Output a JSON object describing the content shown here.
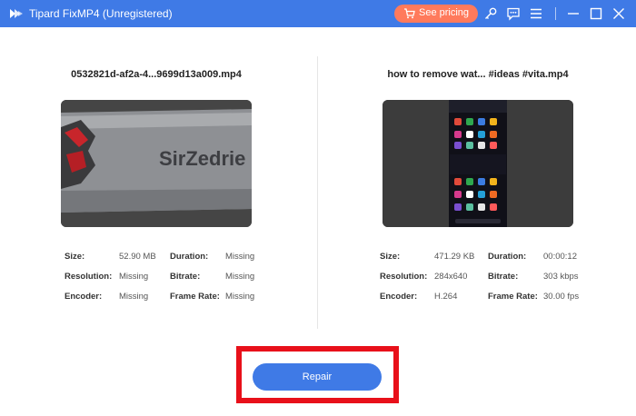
{
  "app": {
    "title": "Tipard FixMP4 (Unregistered)",
    "pricing_label": "See pricing",
    "icons": [
      "logo-icon",
      "cart-icon",
      "key-icon",
      "feedback-icon",
      "menu-icon",
      "minimize-icon",
      "maximize-icon",
      "close-icon"
    ]
  },
  "left": {
    "filename": "0532821d-af2a-4...9699d13a009.mp4",
    "thumb_text": "SirZedrie",
    "props": {
      "size_label": "Size:",
      "size_value": "52.90 MB",
      "duration_label": "Duration:",
      "duration_value": "Missing",
      "resolution_label": "Resolution:",
      "resolution_value": "Missing",
      "bitrate_label": "Bitrate:",
      "bitrate_value": "Missing",
      "encoder_label": "Encoder:",
      "encoder_value": "Missing",
      "framerate_label": "Frame Rate:",
      "framerate_value": "Missing"
    }
  },
  "right": {
    "filename": "how to remove wat... #ideas #vita.mp4",
    "props": {
      "size_label": "Size:",
      "size_value": "471.29 KB",
      "duration_label": "Duration:",
      "duration_value": "00:00:12",
      "resolution_label": "Resolution:",
      "resolution_value": "284x640",
      "bitrate_label": "Bitrate:",
      "bitrate_value": "303 kbps",
      "encoder_label": "Encoder:",
      "encoder_value": "H.264",
      "framerate_label": "Frame Rate:",
      "framerate_value": "30.00 fps"
    }
  },
  "actions": {
    "repair_label": "Repair"
  },
  "colors": {
    "accent": "#3f7ae6",
    "pricing": "#ff7a5c",
    "highlight": "#e8101a"
  }
}
